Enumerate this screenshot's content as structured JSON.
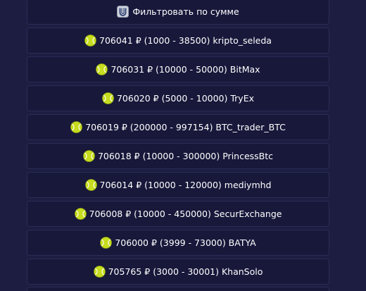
{
  "filter": {
    "label": "Фильтровать по сумме",
    "icon": "filter-badge-icon"
  },
  "orders": [
    {
      "label": "706041 ₽ (1000 - 38500) kripto_seleda",
      "icon": "tennis-ball-icon"
    },
    {
      "label": "706031 ₽ (10000 - 50000) BitMax",
      "icon": "tennis-ball-icon"
    },
    {
      "label": "706020 ₽ (5000 - 10000) TryEx",
      "icon": "tennis-ball-icon"
    },
    {
      "label": "706019 ₽ (200000 - 997154) BTC_trader_BTC",
      "icon": "tennis-ball-icon"
    },
    {
      "label": "706018 ₽ (10000 - 300000) PrincessBtc",
      "icon": "tennis-ball-icon"
    },
    {
      "label": "706014 ₽ (10000 - 120000) mediymhd",
      "icon": "tennis-ball-icon"
    },
    {
      "label": "706008 ₽ (10000 - 450000) SecurExchange",
      "icon": "tennis-ball-icon"
    },
    {
      "label": "706000 ₽ (3999 - 73000) BATYA",
      "icon": "tennis-ball-icon"
    },
    {
      "label": "705765 ₽ (3000 - 30001) KhanSolo",
      "icon": "tennis-ball-icon"
    }
  ],
  "colors": {
    "background": "#1c1d41",
    "button": "#17183a",
    "button_border": "#2b2c55",
    "text": "#ffffff",
    "ball": "#c6dc1e"
  }
}
